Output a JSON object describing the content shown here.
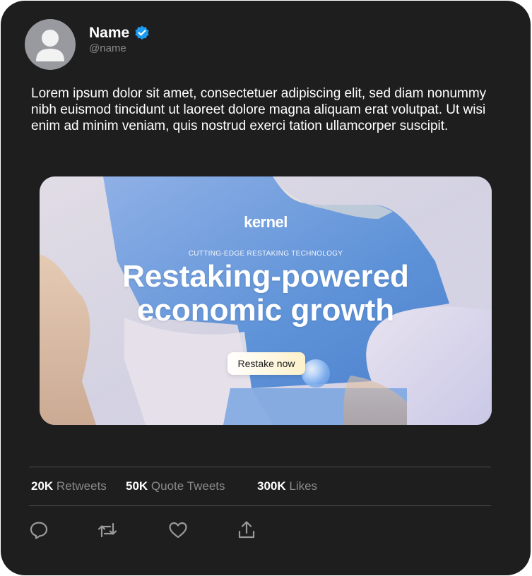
{
  "author": {
    "name": "Name",
    "handle": "@name",
    "verified_color": "#1d9bf0"
  },
  "tweet": {
    "text": "Lorem ipsum dolor sit amet, consectetuer adipiscing elit, sed diam nonummy nibh euismod tincidunt ut laoreet dolore magna aliquam erat volutpat. Ut wisi enim ad minim veniam, quis nostrud exerci tation ullamcorper suscipit."
  },
  "media": {
    "logo": "kernel",
    "kicker": "CUTTING-EDGE RESTAKING TECHNOLOGY",
    "headline_line1": "Restaking-powered",
    "headline_line2": "economic growth",
    "cta_label": "Restake now"
  },
  "stats": {
    "retweets_count": "20K",
    "retweets_label": "Retweets",
    "quotes_count": "50K",
    "quotes_label": "Quote Tweets",
    "likes_count": "300K",
    "likes_label": "Likes"
  },
  "actions": [
    {
      "icon": "reply-icon"
    },
    {
      "icon": "retweet-icon"
    },
    {
      "icon": "like-icon"
    },
    {
      "icon": "share-icon"
    }
  ],
  "colors": {
    "card_background": "#1e1e1e",
    "accent_blue": "#1d9bf0",
    "muted_text": "#8a8a8a"
  }
}
